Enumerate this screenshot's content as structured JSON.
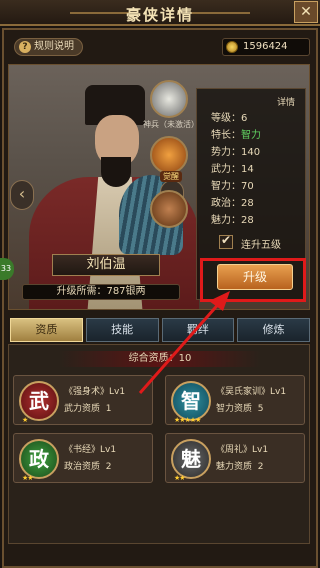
{
  "window": {
    "title": "豪侠详情",
    "close_label": "✕"
  },
  "toolbar": {
    "rules_label": "规则说明",
    "coins": "1596424"
  },
  "hero": {
    "name": "刘伯温",
    "upgrade_cost": "升级所需：787银两",
    "treasures": [
      {
        "label": "神兵（未激活）",
        "icon": "sword-treasure-icon"
      },
      {
        "label": "",
        "badge": "觉醒",
        "icon": "beast-treasure-icon"
      },
      {
        "label": "",
        "icon": "horse-treasure-icon"
      }
    ],
    "side_badge": "33"
  },
  "details": {
    "header": "详情",
    "stats": [
      {
        "label": "等级",
        "value": "6"
      },
      {
        "label": "特长",
        "value": "智力"
      },
      {
        "label": "势力",
        "value": "140"
      },
      {
        "label": "武力",
        "value": "14"
      },
      {
        "label": "智力",
        "value": "70"
      },
      {
        "label": "政治",
        "value": "28"
      },
      {
        "label": "魅力",
        "value": "28"
      }
    ],
    "upgrade_five_label": "连升五级",
    "upgrade_button": "升级"
  },
  "tabs": [
    {
      "label": "资质",
      "active": true
    },
    {
      "label": "技能",
      "active": false
    },
    {
      "label": "羁绊",
      "active": false
    },
    {
      "label": "修炼",
      "active": false
    }
  ],
  "aptitude": {
    "total": "综合资质：10",
    "skills": [
      {
        "glyph": "武",
        "name": "《强身术》Lv1",
        "desc": "武力资质",
        "value": "1",
        "stars": "★",
        "color": "#7a1a1a"
      },
      {
        "glyph": "智",
        "name": "《吴氏家训》Lv1",
        "desc": "智力资质",
        "value": "5",
        "stars": "★★★★★",
        "color": "#1a5a6a"
      },
      {
        "glyph": "政",
        "name": "《书经》Lv1",
        "desc": "政治资质",
        "value": "2",
        "stars": "★★",
        "color": "#2a5a2a"
      },
      {
        "glyph": "魅",
        "name": "《周礼》Lv1",
        "desc": "魅力资质",
        "value": "2",
        "stars": "★★",
        "color": "#3a3a3a"
      }
    ]
  },
  "colors": {
    "accent": "#e01a1a",
    "gold": "#d8b060"
  }
}
